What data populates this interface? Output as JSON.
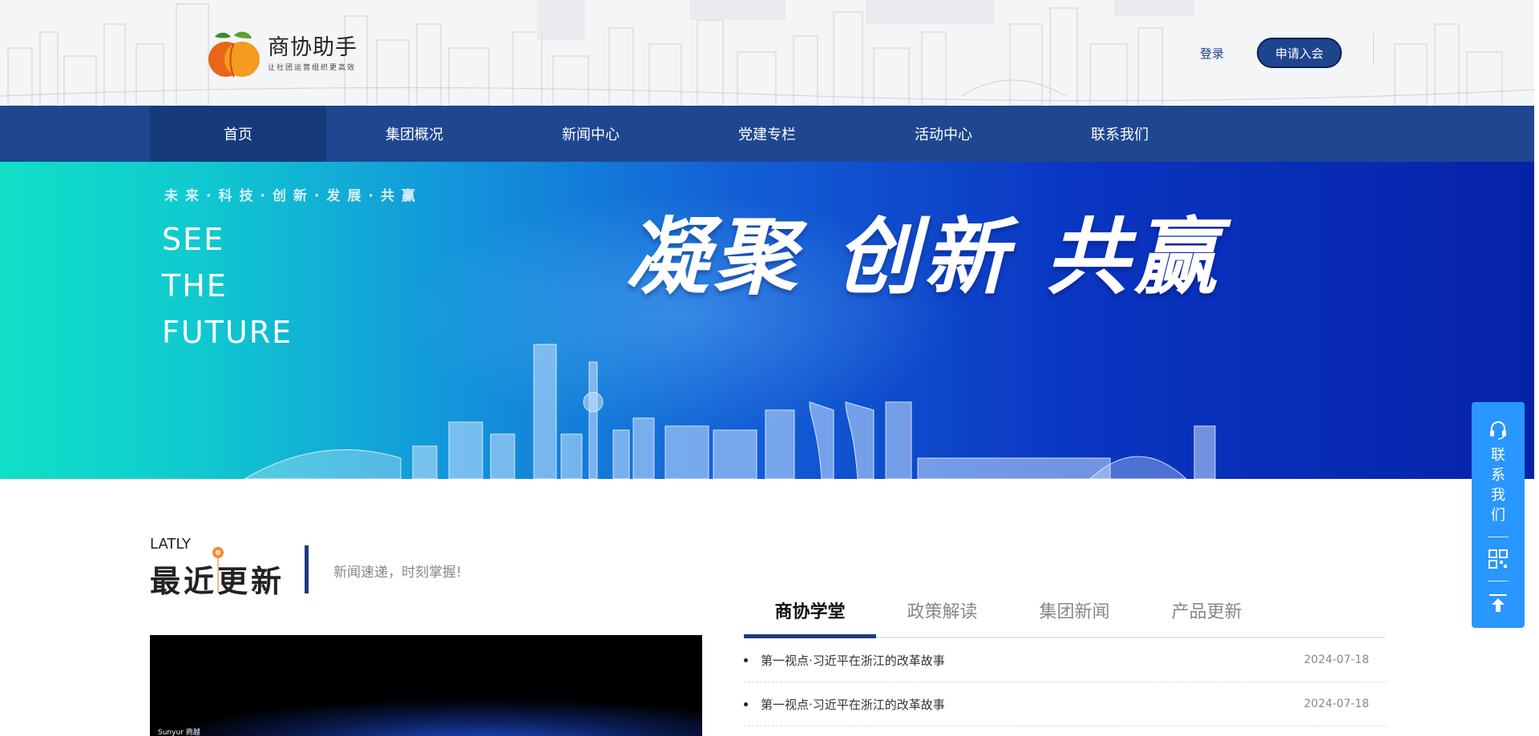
{
  "header": {
    "logo_name": "商协助手",
    "logo_slogan": "让社团运营组织更高效",
    "login_label": "登录",
    "join_label": "申请入会"
  },
  "nav": {
    "items": [
      {
        "label": "首页"
      },
      {
        "label": "集团概况"
      },
      {
        "label": "新闻中心"
      },
      {
        "label": "党建专栏"
      },
      {
        "label": "活动中心"
      },
      {
        "label": "联系我们"
      }
    ],
    "active_index": 0
  },
  "banner": {
    "tagline": "未来·科技·创新·发展·共赢",
    "english_lines": [
      "SEE",
      "THE",
      "FUTURE"
    ],
    "headline": "凝聚 创新 共赢"
  },
  "side_float": {
    "contact_label": "联系我们"
  },
  "section": {
    "en_title": "LATLY",
    "cn_title": "最近更新",
    "subtitle": "新闻速递，时刻掌握!"
  },
  "video": {
    "brand_text": "Sunyur 商越"
  },
  "tabs": [
    {
      "label": "商协学堂"
    },
    {
      "label": "政策解读"
    },
    {
      "label": "集团新闻"
    },
    {
      "label": "产品更新"
    }
  ],
  "news": [
    {
      "title": "第一视点·习近平在浙江的改革故事",
      "date": "2024-07-18"
    },
    {
      "title": "第一视点·习近平在浙江的改革故事",
      "date": "2024-07-18"
    }
  ],
  "colors": {
    "nav_bg": "#1e478f",
    "accent": "#1e3a80",
    "side_float": "#2a96ff",
    "logo_orange": "#f07a1a"
  }
}
